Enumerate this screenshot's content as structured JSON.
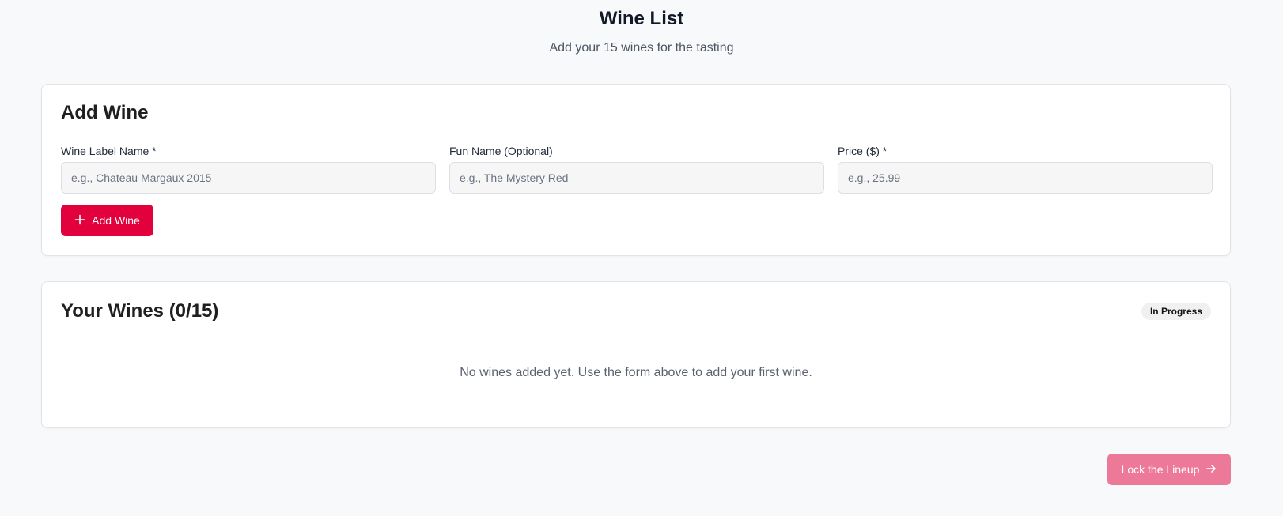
{
  "header": {
    "title": "Wine List",
    "subtitle": "Add your 15 wines for the tasting"
  },
  "add_wine": {
    "title": "Add Wine",
    "fields": [
      {
        "label": "Wine Label Name *",
        "placeholder": "e.g., Chateau Margaux 2015",
        "value": ""
      },
      {
        "label": "Fun Name (Optional)",
        "placeholder": "e.g., The Mystery Red",
        "value": ""
      },
      {
        "label": "Price ($) *",
        "placeholder": "e.g., 25.99",
        "value": ""
      }
    ],
    "button_label": "Add Wine",
    "button_icon": "plus-icon"
  },
  "wine_list": {
    "title": "Your Wines (0/15)",
    "status_badge": "In Progress",
    "empty_message": "No wines added yet. Use the form above to add your first wine."
  },
  "footer": {
    "lock_button_label": "Lock the Lineup",
    "lock_button_icon": "arrow-right-icon",
    "lock_button_enabled": false
  },
  "colors": {
    "accent": "#e2003d",
    "accent_disabled": "#ec7997",
    "background": "#f8f9fa"
  }
}
